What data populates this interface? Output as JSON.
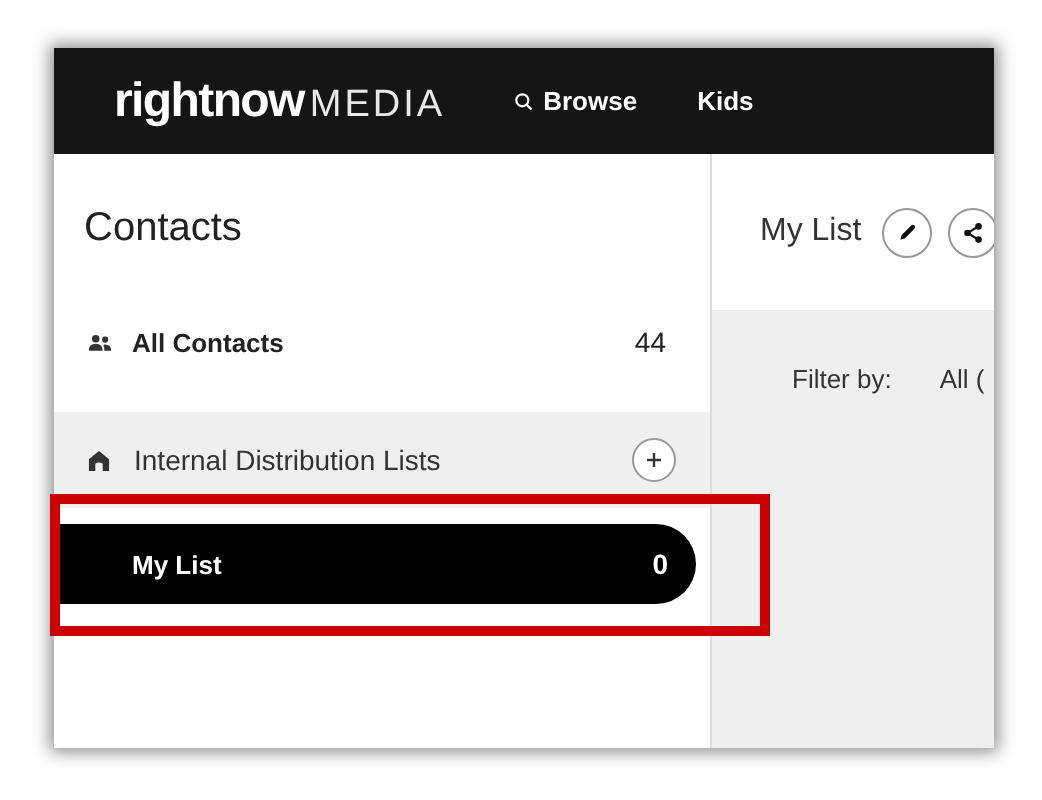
{
  "header": {
    "logo": {
      "word": "rightnow",
      "suffix": "MEDIA"
    },
    "nav": [
      {
        "kind": "search",
        "label": "Browse"
      },
      {
        "kind": "link",
        "label": "Kids"
      }
    ]
  },
  "sidebar": {
    "title": "Contacts",
    "items": [
      {
        "kind": "item",
        "label": "All Contacts",
        "count": "44",
        "selected": false
      },
      {
        "kind": "section",
        "label": "Internal Distribution Lists"
      },
      {
        "kind": "item",
        "label": "My List",
        "count": "0",
        "selected": true
      }
    ]
  },
  "main": {
    "title": "My List",
    "filter_label": "Filter by:",
    "filter_value": "All ("
  }
}
